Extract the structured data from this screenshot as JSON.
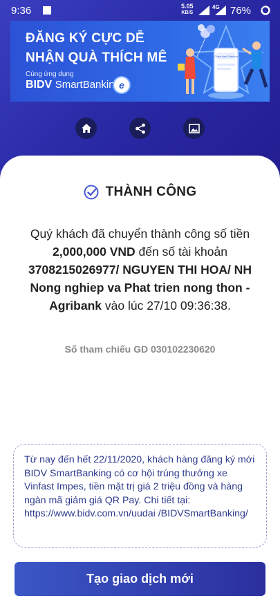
{
  "status_bar": {
    "time": "9:36",
    "speed": "5.05",
    "speed_unit": "KB/S",
    "network": "4G",
    "battery": "76%"
  },
  "banner": {
    "line1": "ĐĂNG KÝ CỰC DỄ",
    "line2": "NHẬN QUÀ THÍCH MÊ",
    "subtitle": "Cùng ứng dụng",
    "brand_bold": "BIDV",
    "brand_light": "SmartBanking",
    "logo_letter": "e",
    "phone_label": "Chào bạn Giakhoa"
  },
  "actions": {
    "home": "home-icon",
    "share": "share-icon",
    "image": "image-icon"
  },
  "result": {
    "status": "THÀNH CÔNG",
    "msg_part1": "Quý khách đã chuyển thành công số tiền ",
    "amount": "2,000,000 VND",
    "msg_part2": " đến số tài khoản ",
    "account": "3708215026977/ NGUYEN THI HOA/ NH Nong nghiep va Phat trien nong thon - Agribank",
    "msg_part3": " vào lúc 27/10 09:36:38.",
    "reference": "Số tham chiếu GD 030102230620"
  },
  "promo": {
    "text": "Từ nay đến hết 22/11/2020, khách hàng đăng ký mới BIDV SmartBanking có cơ hội trúng thưởng xe Vinfast Impes, tiền mặt trị giá 2 triệu đồng và hàng ngàn mã giảm giá QR Pay. Chi tiết tại: https://www.bidv.com.vn/uudai /BIDVSmartBanking/"
  },
  "cta": {
    "label": "Tạo giao dịch mới"
  },
  "colors": {
    "primary": "#2b2f9e",
    "promo_text": "#2d3a8c",
    "success_icon": "#4a5ad6"
  }
}
